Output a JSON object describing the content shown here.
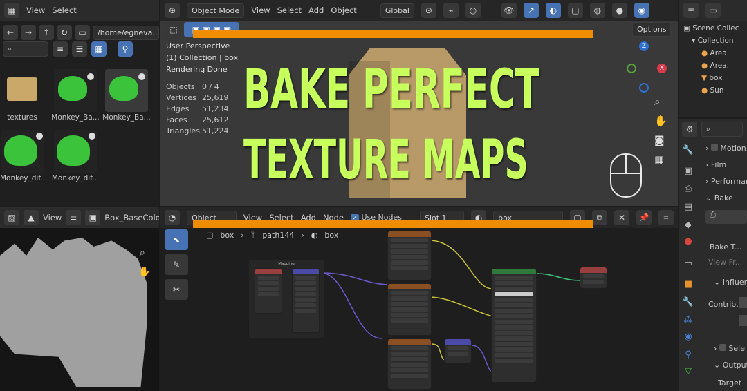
{
  "title_overlay": {
    "line1": "BAKE PERFECT",
    "line2": "TEXTURE MAPS",
    "bar_color": "#f08c00",
    "text_color": "#c7ff5c"
  },
  "file_browser": {
    "menu": [
      "View",
      "Select"
    ],
    "path": "/home/egneva...",
    "search_placeholder": "",
    "items": [
      {
        "name": "textures",
        "kind": "folder-icon"
      },
      {
        "name": "Monkey_Ba...",
        "kind": "image"
      },
      {
        "name": "Monkey_Ba...",
        "kind": "image"
      },
      {
        "name": "Monkey_dif...",
        "kind": "image"
      },
      {
        "name": "Monkey_dif...",
        "kind": "image"
      }
    ]
  },
  "viewport": {
    "mode": "Object Mode",
    "menu": [
      "View",
      "Select",
      "Add",
      "Object"
    ],
    "transform": "Global",
    "options": "Options",
    "info": [
      "User Perspective",
      "(1) Collection | box",
      "Rendering Done"
    ],
    "stats": [
      {
        "label": "Objects",
        "value": "0 / 4"
      },
      {
        "label": "Vertices",
        "value": "25,619"
      },
      {
        "label": "Edges",
        "value": "51,234"
      },
      {
        "label": "Faces",
        "value": "25,612"
      },
      {
        "label": "Triangles",
        "value": "51,224"
      }
    ],
    "gizmo": {
      "z": "Z",
      "x": "X"
    }
  },
  "outliner": {
    "items": [
      "Scene Collec",
      "Collection",
      "Area",
      "Area.",
      "box",
      "Sun"
    ]
  },
  "properties": {
    "search_placeholder": "",
    "rows": [
      "Motion",
      "Film",
      "Performan",
      "Bake",
      "Bake T...",
      "View Fr...",
      "Influen",
      "Contrib...",
      "Sele",
      "Output",
      "Target"
    ]
  },
  "image_editor": {
    "menu": "View",
    "image_name": "Box_BaseColo"
  },
  "node_editor": {
    "type": "Object",
    "menu": [
      "View",
      "Select",
      "Add",
      "Node"
    ],
    "use_nodes": "Use Nodes",
    "slot": "Slot 1",
    "material": "box",
    "breadcrumb": [
      "box",
      "path144",
      "box"
    ],
    "frame_label": "Mapping"
  }
}
